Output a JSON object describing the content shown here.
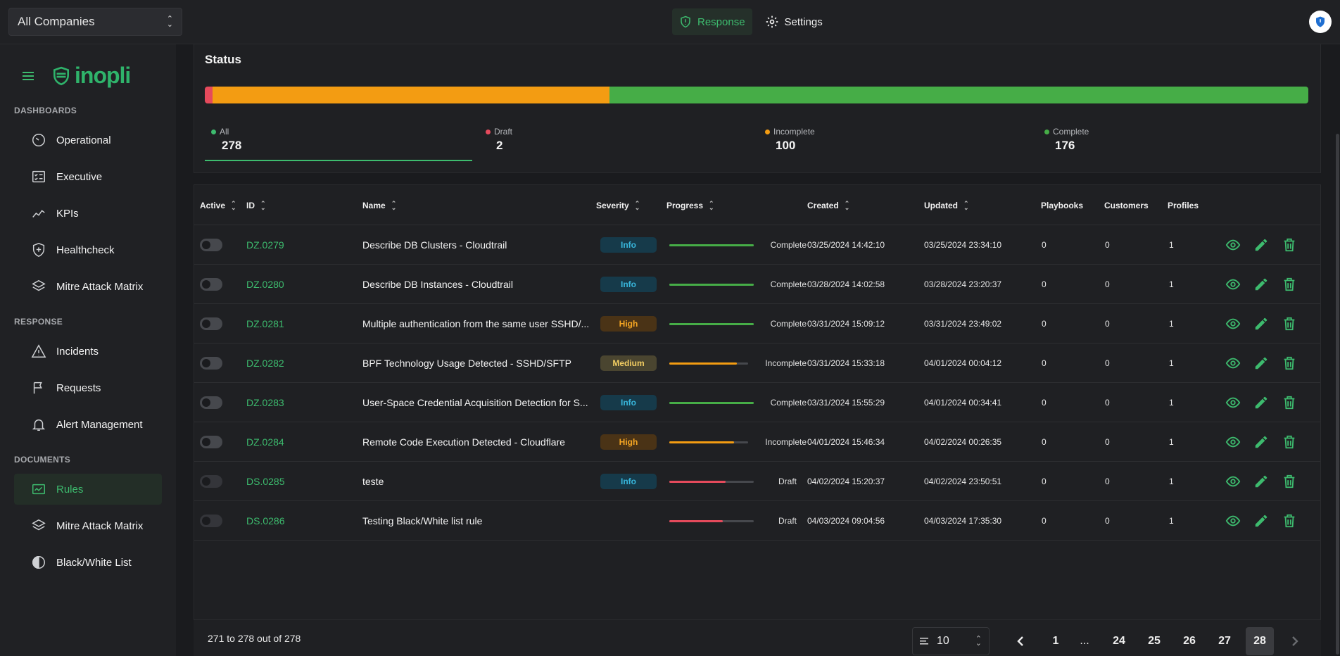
{
  "topbar": {
    "company": "All Companies",
    "nav": [
      {
        "label": "Response",
        "active": true
      },
      {
        "label": "Settings",
        "active": false
      }
    ]
  },
  "sidebar": {
    "brand": "inopli",
    "sections": [
      {
        "label": "DASHBOARDS",
        "items": [
          "Operational",
          "Executive",
          "KPIs",
          "Healthcheck",
          "Mitre Attack Matrix"
        ]
      },
      {
        "label": "RESPONSE",
        "items": [
          "Incidents",
          "Requests",
          "Alert Management"
        ]
      },
      {
        "label": "DOCUMENTS",
        "items": [
          "Rules",
          "Mitre Attack Matrix",
          "Black/White List"
        ]
      }
    ],
    "active_item": "Rules"
  },
  "status": {
    "title": "Status",
    "stats": [
      {
        "label": "All",
        "value": "278",
        "color": "#3dbb6e"
      },
      {
        "label": "Draft",
        "value": "2",
        "color": "#e54a5c"
      },
      {
        "label": "Incomplete",
        "value": "100",
        "color": "#f39c12"
      },
      {
        "label": "Complete",
        "value": "176",
        "color": "#46ad47"
      }
    ],
    "distribution": {
      "draft": 2,
      "incomplete": 100,
      "complete": 176,
      "total": 278
    }
  },
  "table": {
    "headers": {
      "active": "Active",
      "id": "ID",
      "name": "Name",
      "severity": "Severity",
      "progress": "Progress",
      "created": "Created",
      "updated": "Updated",
      "playbooks": "Playbooks",
      "customers": "Customers",
      "profiles": "Profiles"
    },
    "rows": [
      {
        "id": "DZ.0279",
        "name": "Describe DB Clusters - Cloudtrail",
        "severity": "Info",
        "progress": 100,
        "status": "Complete",
        "created": "03/25/2024 14:42:10",
        "updated": "03/25/2024 23:34:10",
        "playbooks": "0",
        "customers": "0",
        "profiles": "1"
      },
      {
        "id": "DZ.0280",
        "name": "Describe DB Instances - Cloudtrail",
        "severity": "Info",
        "progress": 100,
        "status": "Complete",
        "created": "03/28/2024 14:02:58",
        "updated": "03/28/2024 23:20:37",
        "playbooks": "0",
        "customers": "0",
        "profiles": "1"
      },
      {
        "id": "DZ.0281",
        "name": "Multiple authentication from the same user SSHD/...",
        "severity": "High",
        "progress": 100,
        "status": "Complete",
        "created": "03/31/2024 15:09:12",
        "updated": "03/31/2024 23:49:02",
        "playbooks": "0",
        "customers": "0",
        "profiles": "1"
      },
      {
        "id": "DZ.0282",
        "name": "BPF Technology Usage Detected - SSHD/SFTP",
        "severity": "Medium",
        "progress": 86,
        "status": "Incomplete",
        "created": "03/31/2024 15:33:18",
        "updated": "04/01/2024 00:04:12",
        "playbooks": "0",
        "customers": "0",
        "profiles": "1"
      },
      {
        "id": "DZ.0283",
        "name": "User-Space Credential Acquisition Detection for S...",
        "severity": "Info",
        "progress": 100,
        "status": "Complete",
        "created": "03/31/2024 15:55:29",
        "updated": "04/01/2024 00:34:41",
        "playbooks": "0",
        "customers": "0",
        "profiles": "1"
      },
      {
        "id": "DZ.0284",
        "name": "Remote Code Execution Detected - Cloudflare",
        "severity": "High",
        "progress": 82,
        "status": "Incomplete",
        "created": "04/01/2024 15:46:34",
        "updated": "04/02/2024 00:26:35",
        "playbooks": "0",
        "customers": "0",
        "profiles": "1"
      },
      {
        "id": "DS.0285",
        "name": "teste",
        "severity": "Info",
        "progress": 67,
        "status": "Draft",
        "created": "04/02/2024 15:20:37",
        "updated": "04/02/2024 23:50:51",
        "playbooks": "0",
        "customers": "0",
        "profiles": "1"
      },
      {
        "id": "DS.0286",
        "name": "Testing Black/White list rule",
        "severity": "",
        "progress": 63,
        "status": "Draft",
        "created": "04/03/2024 09:04:56",
        "updated": "04/03/2024 17:35:30",
        "playbooks": "0",
        "customers": "0",
        "profiles": "1"
      }
    ]
  },
  "footer": {
    "range": "271 to 278 out of 278",
    "page_size": "10",
    "pages": [
      "1",
      "...",
      "24",
      "25",
      "26",
      "27",
      "28"
    ],
    "current_page": "28"
  },
  "colors": {
    "accent": "#3dbb6e",
    "draft": "#e54a5c",
    "incomplete": "#f39c12",
    "complete": "#46ad47"
  },
  "icons": {
    "topbar": [
      "shield-icon",
      "gear-icon",
      "avatar-shield-icon"
    ],
    "sidebar": [
      "gauge-icon",
      "checklist-icon",
      "trend-icon",
      "shield-plus-icon",
      "layers-icon",
      "warning-icon",
      "flag-icon",
      "bell-icon",
      "rules-icon",
      "layers-icon",
      "half-circle-icon"
    ],
    "actions": [
      "eye-icon",
      "pencil-icon",
      "trash-icon"
    ]
  }
}
